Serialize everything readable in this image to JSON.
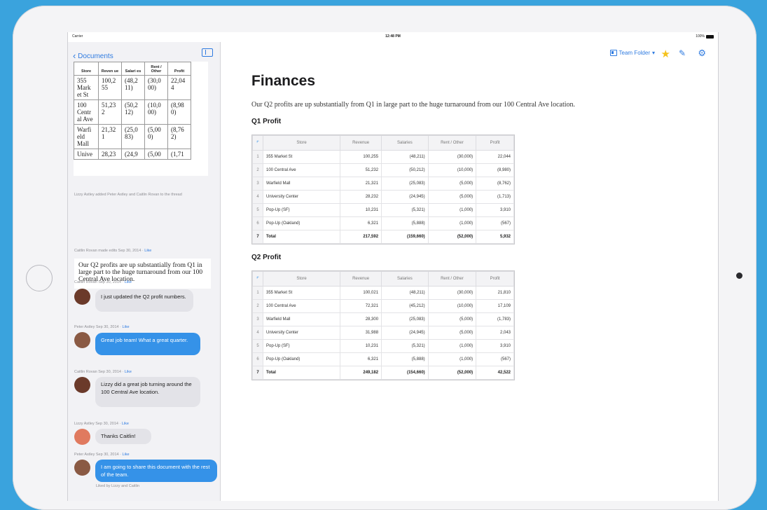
{
  "status_bar": {
    "carrier": "Carrier",
    "time": "12:48 PM",
    "battery": "100%"
  },
  "sidebar": {
    "back_label": "Documents",
    "mini_table": {
      "headers": [
        "Store",
        "Reven ue",
        "Salari es",
        "Rent / Other",
        "Profit"
      ],
      "rows": [
        [
          "355 Mark et St",
          "100,2 55",
          "(48,2 11)",
          "(30,0 00)",
          "22,04 4"
        ],
        [
          "100 Centr al Ave",
          "51,23 2",
          "(50,2 12)",
          "(10,0 00)",
          "(8,98 0)"
        ],
        [
          "Warfi eld Mall",
          "21,32 1",
          "(25,0 83)",
          "(5,00 0)",
          "(8,76 2)"
        ],
        [
          "Unive",
          "28,23",
          "(24,9",
          "(5,00",
          "(1,71"
        ]
      ]
    },
    "activity_note": "Lizzy Astley added Peter Astley and Caitlin Rovan to the thread",
    "edit_meta": {
      "text": "Caitlin Rovan made edits Sep 30, 2014 · ",
      "like": "Like"
    },
    "quote": "Our Q2 profits are up substantially from Q1 in large part to the huge turnaround from our 100 Central Ave location.",
    "messages": [
      {
        "meta": "Caitlin Rovan Sep 30, 2014 · ",
        "like": "Like",
        "text": "I just updated the Q2 profit numbers.",
        "style": "gray",
        "avatar_color": "#6b3a2a"
      },
      {
        "meta": "Peter Astley Sep 30, 2014 · ",
        "like": "Like",
        "text": "Great job team! What a great quarter.",
        "style": "blue",
        "avatar_color": "#8a5a44"
      },
      {
        "meta": "Caitlin Rovan Sep 30, 2014 · ",
        "like": "Like",
        "text": "Lizzy did a great job turning around the 100 Central Ave location.",
        "style": "gray",
        "avatar_color": "#6b3a2a"
      },
      {
        "meta": "Lizzy Astley Sep 30, 2014 · ",
        "like": "Like",
        "text": "Thanks Caitlin!",
        "style": "gray",
        "avatar_color": "#e07a5f"
      },
      {
        "meta": "Peter Astley Sep 30, 2014 · ",
        "like": "Like",
        "text": "I am going to share this document with the rest of the team.",
        "style": "blue",
        "avatar_color": "#8a5a44"
      }
    ],
    "liked_by": "Liked by Lizzy and Caitlin"
  },
  "toolbar": {
    "folder_label": "Team Folder",
    "folder_caret": "▾"
  },
  "document": {
    "title": "Finances",
    "paragraph": "Our Q2 profits are up substantially from Q1 in large part to the huge turnaround from our 100 Central Ave location.",
    "tables": [
      {
        "heading": "Q1 Profit",
        "headers": [
          "Store",
          "Revenue",
          "Salaries",
          "Rent / Other",
          "Profit"
        ],
        "rows": [
          [
            "1",
            "355 Market St",
            "100,255",
            "(48,211)",
            "(30,000)",
            "22,044"
          ],
          [
            "2",
            "100 Central Ave",
            "51,232",
            "(50,212)",
            "(10,000)",
            "(8,980)"
          ],
          [
            "3",
            "Warfield Mall",
            "21,321",
            "(25,083)",
            "(5,000)",
            "(8,762)"
          ],
          [
            "4",
            "University Center",
            "28,232",
            "(24,945)",
            "(5,000)",
            "(1,713)"
          ],
          [
            "5",
            "Pop-Up (SF)",
            "10,231",
            "(5,321)",
            "(1,000)",
            "3,910"
          ],
          [
            "6",
            "Pop-Up (Oakland)",
            "6,321",
            "(5,888)",
            "(1,000)",
            "(567)"
          ],
          [
            "7",
            "Total",
            "217,592",
            "(159,660)",
            "(52,000)",
            "5,932"
          ]
        ]
      },
      {
        "heading": "Q2 Profit",
        "headers": [
          "Store",
          "Revenue",
          "Salaries",
          "Rent / Other",
          "Profit"
        ],
        "rows": [
          [
            "1",
            "355 Market St",
            "100,021",
            "(48,211)",
            "(30,000)",
            "21,810"
          ],
          [
            "2",
            "100 Central Ave",
            "72,321",
            "(45,212)",
            "(10,000)",
            "17,109"
          ],
          [
            "3",
            "Warfield Mall",
            "28,300",
            "(25,083)",
            "(5,000)",
            "(1,783)"
          ],
          [
            "4",
            "University Center",
            "31,988",
            "(24,945)",
            "(5,000)",
            "2,043"
          ],
          [
            "5",
            "Pop-Up (SF)",
            "10,231",
            "(5,321)",
            "(1,000)",
            "3,910"
          ],
          [
            "6",
            "Pop-Up (Oakland)",
            "6,321",
            "(5,888)",
            "(1,000)",
            "(567)"
          ],
          [
            "7",
            "Total",
            "249,182",
            "(154,660)",
            "(52,000)",
            "42,522"
          ]
        ]
      }
    ]
  }
}
